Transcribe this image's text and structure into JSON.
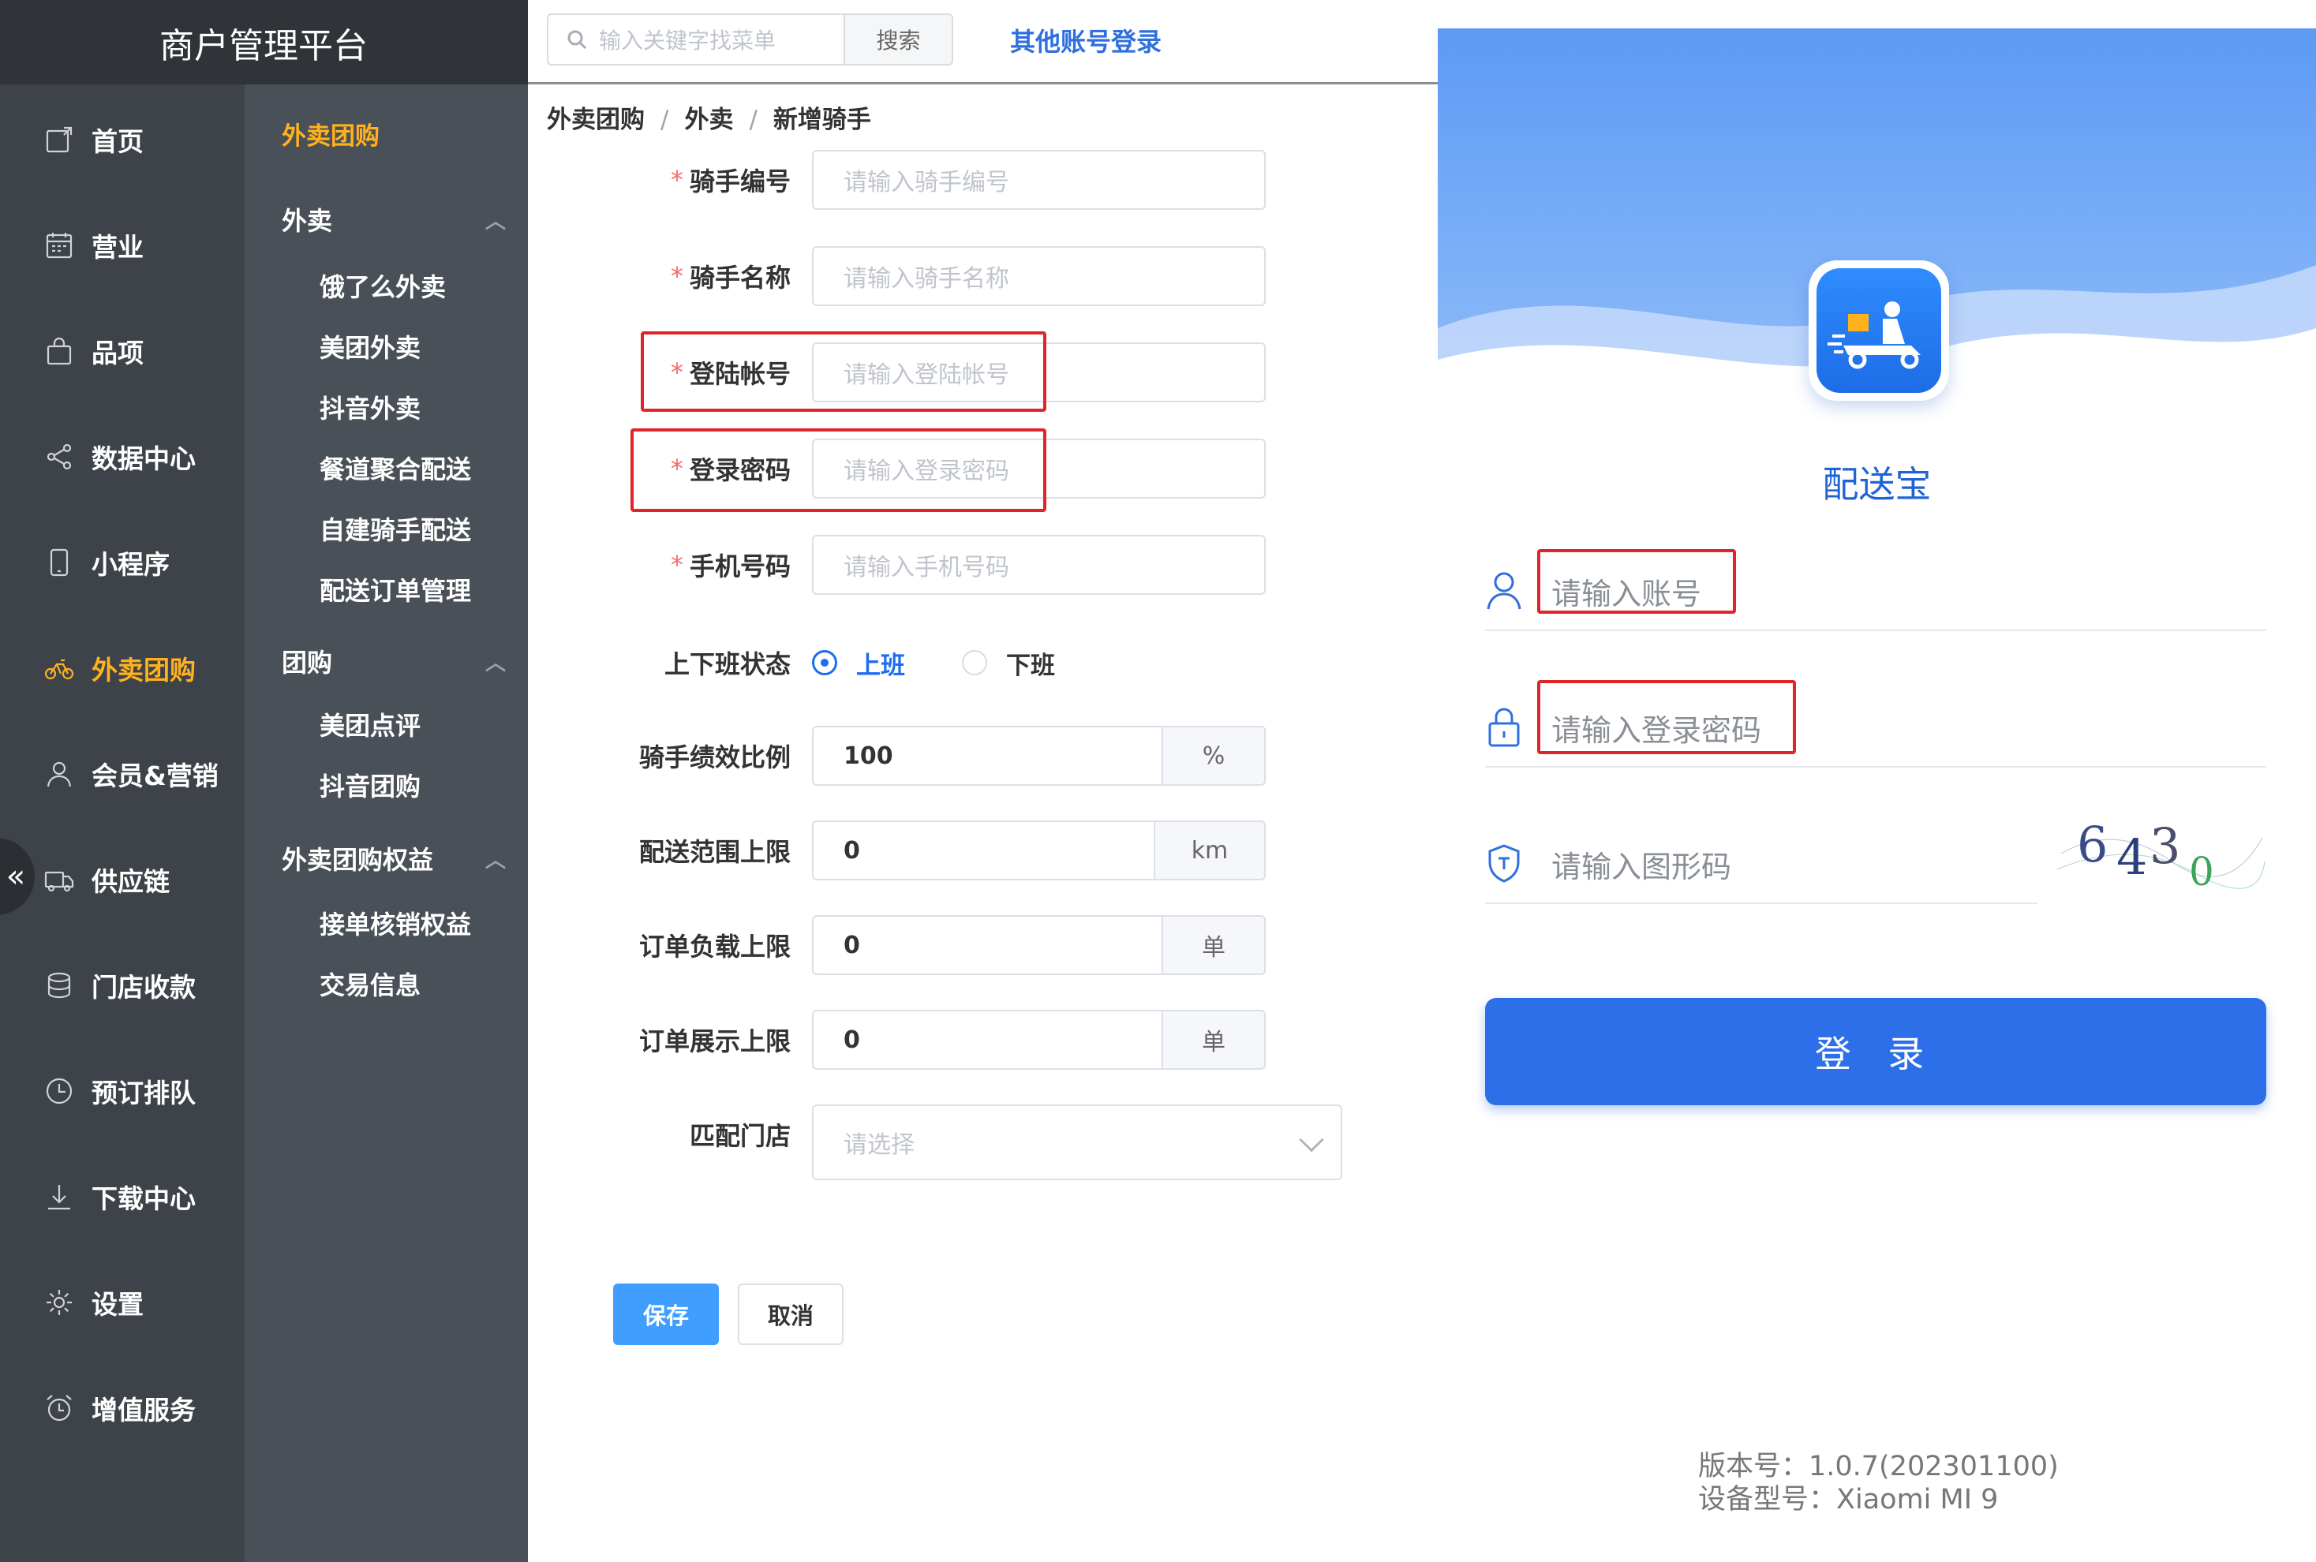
{
  "brand": "商户管理平台",
  "nav": [
    {
      "label": "首页",
      "icon": "home-icon"
    },
    {
      "label": "营业",
      "icon": "calendar-icon"
    },
    {
      "label": "品项",
      "icon": "bag-icon"
    },
    {
      "label": "数据中心",
      "icon": "share-icon"
    },
    {
      "label": "小程序",
      "icon": "phone-icon"
    },
    {
      "label": "外卖团购",
      "icon": "bike-icon",
      "active": true
    },
    {
      "label": "会员&营销",
      "icon": "user-icon"
    },
    {
      "label": "供应链",
      "icon": "truck-icon"
    },
    {
      "label": "门店收款",
      "icon": "database-icon"
    },
    {
      "label": "预订排队",
      "icon": "clock-icon"
    },
    {
      "label": "下载中心",
      "icon": "download-icon"
    },
    {
      "label": "设置",
      "icon": "gear-icon"
    },
    {
      "label": "增值服务",
      "icon": "alarm-icon"
    }
  ],
  "collapse_glyph": "«",
  "subnav": {
    "title": "外卖团购",
    "groups": [
      {
        "label": "外卖",
        "items": [
          "饿了么外卖",
          "美团外卖",
          "抖音外卖",
          "餐道聚合配送",
          "自建骑手配送",
          "配送订单管理"
        ]
      },
      {
        "label": "团购",
        "items": [
          "美团点评",
          "抖音团购"
        ]
      },
      {
        "label": "外卖团购权益",
        "items": [
          "接单核销权益",
          "交易信息"
        ]
      }
    ]
  },
  "topbar": {
    "search_placeholder": "输入关键字找菜单",
    "search_button": "搜索",
    "other_login": "其他账号登录"
  },
  "breadcrumb": [
    "外卖团购",
    "外卖",
    "新增骑手"
  ],
  "breadcrumb_sep": "/",
  "form": {
    "rider_no": {
      "label": "骑手编号",
      "placeholder": "请输入骑手编号"
    },
    "rider_name": {
      "label": "骑手名称",
      "placeholder": "请输入骑手名称"
    },
    "login_account": {
      "label": "登陆帐号",
      "placeholder": "请输入登陆帐号"
    },
    "login_password": {
      "label": "登录密码",
      "placeholder": "请输入登录密码"
    },
    "phone": {
      "label": "手机号码",
      "placeholder": "请输入手机号码"
    },
    "shift_status": {
      "label": "上下班状态",
      "options": [
        "上班",
        "下班"
      ],
      "selected": "上班"
    },
    "performance_ratio": {
      "label": "骑手绩效比例",
      "value": "100",
      "unit": "%"
    },
    "delivery_range": {
      "label": "配送范围上限",
      "value": "0",
      "unit": "km"
    },
    "order_load": {
      "label": "订单负载上限",
      "value": "0",
      "unit": "单"
    },
    "order_display": {
      "label": "订单展示上限",
      "value": "0",
      "unit": "单"
    },
    "match_store": {
      "label": "匹配门店",
      "placeholder": "请选择"
    },
    "required_mark": "*",
    "save": "保存",
    "cancel": "取消"
  },
  "login": {
    "app_name": "配送宝",
    "account_placeholder": "请输入账号",
    "password_placeholder": "请输入登录密码",
    "captcha_placeholder": "请输入图形码",
    "captcha_code": "6430",
    "submit": "登 录",
    "version": "版本号：1.0.7(202301100)",
    "device": "设备型号：Xiaomi MI 9"
  },
  "colors": {
    "accent_blue": "#2d6fe8",
    "nav_active": "#ffb21d",
    "highlight_red": "#e0242a",
    "required_red": "#f56c6c"
  }
}
